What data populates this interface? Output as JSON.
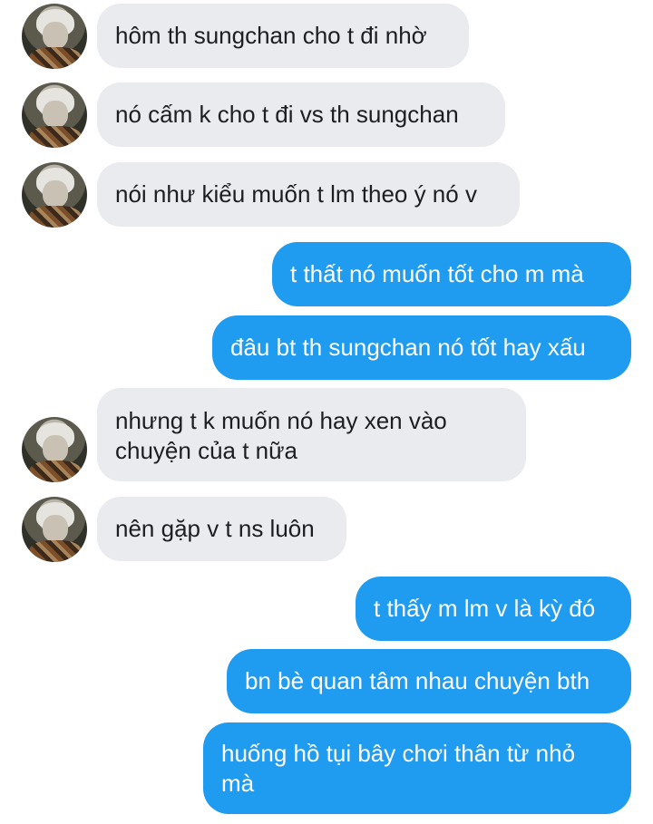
{
  "messages": [
    {
      "side": "in",
      "text": "hôm th sungchan cho t đi nhờ"
    },
    {
      "side": "in",
      "text": "nó cấm k cho t đi vs th sungchan"
    },
    {
      "side": "in",
      "text": "nói như kiểu muốn t lm theo ý nó v"
    },
    {
      "side": "out",
      "text": "t thất nó muốn tốt cho m mà"
    },
    {
      "side": "out",
      "text": "đâu bt th sungchan nó tốt hay xấu"
    },
    {
      "side": "in",
      "text": "nhưng t k muốn nó hay xen vào chuyện của t nữa"
    },
    {
      "side": "in",
      "text": "nên gặp v t ns luôn"
    },
    {
      "side": "out",
      "text": "t thấy m lm v là kỳ đó"
    },
    {
      "side": "out",
      "text": "bn bè quan tâm nhau chuyện bth"
    },
    {
      "side": "out",
      "text": "huống hồ tụi bây chơi thân từ nhỏ mà"
    }
  ],
  "colors": {
    "incoming_bg": "#e9ebee",
    "outgoing_bg": "#1f9bf0"
  },
  "avatar_icon": "profile-photo"
}
